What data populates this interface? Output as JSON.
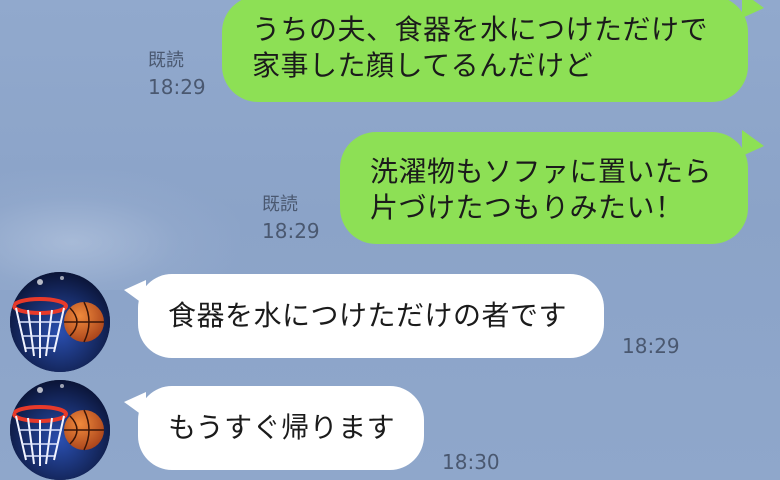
{
  "colors": {
    "background": "#8ca4c8",
    "outgoing_bubble": "#8de055",
    "incoming_bubble": "#ffffff",
    "meta_text": "#4a5870"
  },
  "messages": [
    {
      "direction": "outgoing",
      "text": "うちの夫、食器を水につけただけで\n家事した顔してるんだけど",
      "read_label": "既読",
      "time": "18:29"
    },
    {
      "direction": "outgoing",
      "text": "洗濯物もソファに置いたら\n片づけたつもりみたい！",
      "read_label": "既読",
      "time": "18:29"
    },
    {
      "direction": "incoming",
      "avatar": "basketball-hoop-avatar",
      "text": "食器を水につけただけの者です",
      "time": "18:29"
    },
    {
      "direction": "incoming",
      "avatar": "basketball-hoop-avatar",
      "text": "もうすぐ帰ります",
      "time": "18:30"
    }
  ]
}
